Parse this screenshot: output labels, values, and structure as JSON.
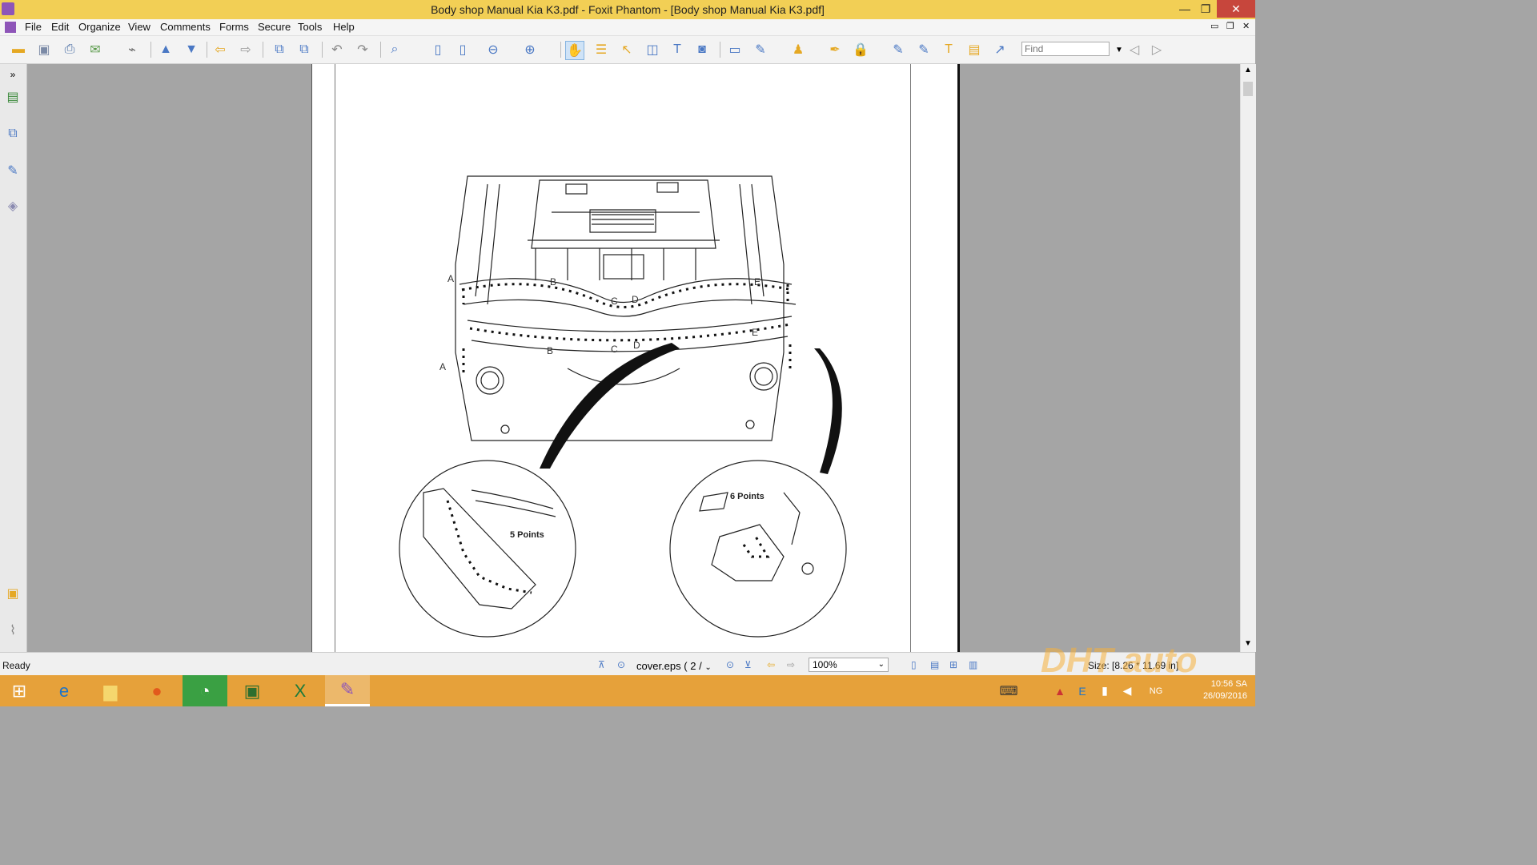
{
  "window": {
    "title": "Body shop Manual Kia K3.pdf - Foxit Phantom - [Body shop Manual Kia K3.pdf]",
    "minimize": "—",
    "maximize": "❐",
    "close": "✕"
  },
  "menu": [
    "File",
    "Edit",
    "Organize",
    "View",
    "Comments",
    "Forms",
    "Secure",
    "Tools",
    "Help"
  ],
  "toolbar": {
    "find_placeholder": "Find"
  },
  "diagram": {
    "labels": {
      "a": "A",
      "b": "B",
      "c": "C",
      "d": "D",
      "e": "E",
      "left_callout": "5 Points",
      "right_callout": "6 Points"
    }
  },
  "status": {
    "ready": "Ready",
    "page_name": "cover.eps",
    "page_of": "( 2 /",
    "zoom": "100%",
    "size": "Size: [8.26 * 11.69 in]"
  },
  "taskbar": {
    "clock_time": "10:56 SA",
    "clock_date": "26/09/2016",
    "lang": "NG"
  },
  "watermark": "DHT auto",
  "colors": {
    "titlebar": "#f2cf55",
    "taskbar": "#e6a13a",
    "close_button": "#c7463c"
  }
}
